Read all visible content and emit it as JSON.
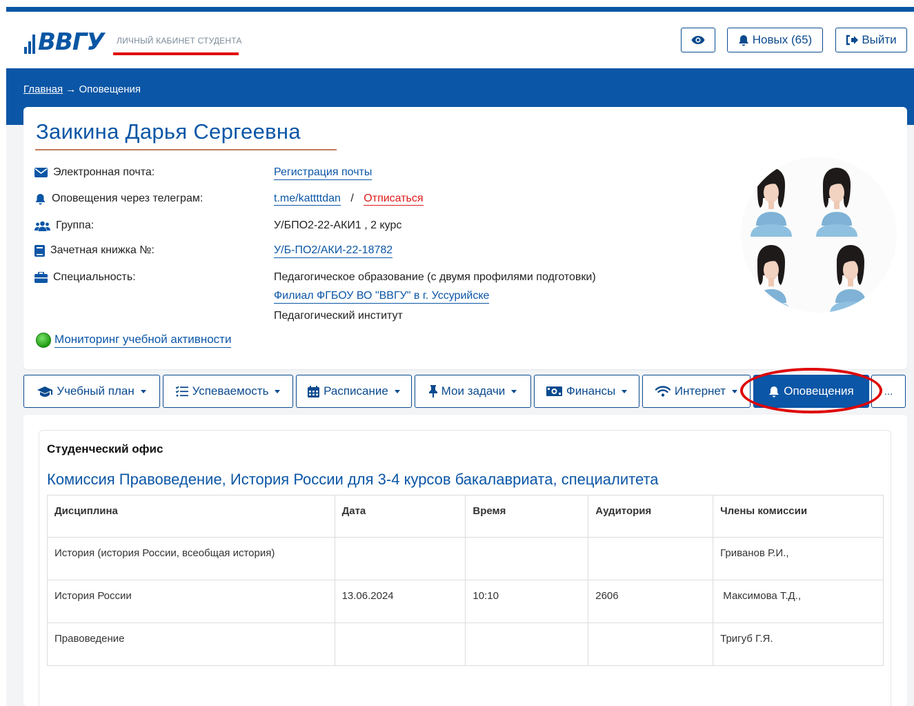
{
  "header": {
    "logo_text": "ВВГУ",
    "cabinet_label": "ЛИЧНЫЙ КАБИНЕТ СТУДЕНТА",
    "new_label": "Новых (65)",
    "logout_label": "Выйти"
  },
  "breadcrumb": {
    "home": "Главная",
    "arrow": "→",
    "current": "Оповещения"
  },
  "profile": {
    "name": "Заикина Дарья Сергеевна",
    "rows": [
      {
        "label": "Электронная почта:",
        "value": "Регистрация почты"
      },
      {
        "label": "Оповещения через телеграм:",
        "value": "t.me/kattttdan",
        "separator": "/",
        "unsubscribe": "Отписаться"
      },
      {
        "label": "Группа:",
        "value": "У/БПО2-22-АКИ1 , 2 курс"
      },
      {
        "label": "Зачетная книжка №:",
        "value": "У/Б-ПО2/АКИ-22-18782"
      },
      {
        "label": "Специальность:",
        "value": "Педагогическое образование (с двумя профилями подготовки)",
        "branch": "Филиал ФГБОУ ВО \"ВВГУ\" в г. Уссурийске",
        "institute": "Педагогический институт"
      }
    ],
    "monitoring": "Мониторинг учебной активности"
  },
  "nav": {
    "items": [
      "Учебный план",
      "Успеваемость",
      "Расписание",
      "Мои задачи",
      "Финансы",
      "Интернет",
      "Оповещения",
      "..."
    ],
    "active": "Оповещения"
  },
  "content": {
    "office_title": "Студенческий офис",
    "commission_title": "Комиссия Правоведение, История России для 3-4 курсов бакалавриата, специалитета",
    "columns": [
      "Дисциплина",
      "Дата",
      "Время",
      "Аудитория",
      "Члены комиссии"
    ],
    "rows": [
      [
        "История (история России, всеобщая история)",
        "",
        "",
        "",
        "Гриванов Р.И.,"
      ],
      [
        "История России",
        "13.06.2024",
        "10:10",
        "2606",
        " Максимова Т.Д.,"
      ],
      [
        "Правоведение",
        "",
        "",
        "",
        "Тригуб Г.Я."
      ]
    ]
  },
  "colors": {
    "brand_blue": "#0b56a6",
    "highlight_red": "#e00000",
    "link_red": "#e01b1b"
  }
}
